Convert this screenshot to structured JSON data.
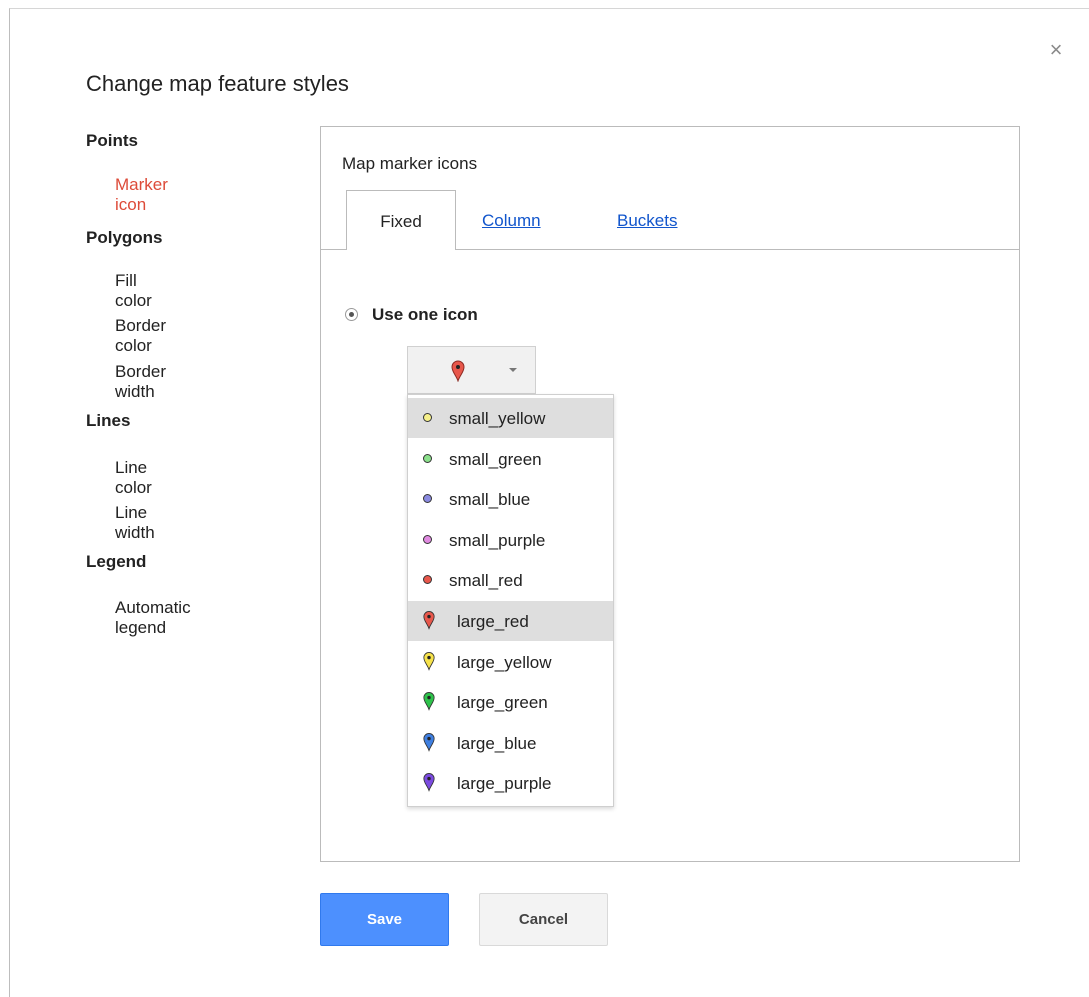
{
  "dialog": {
    "title": "Change map feature styles",
    "close_label": "×"
  },
  "nav": {
    "sections": [
      {
        "heading": "Points",
        "items": [
          "Marker icon"
        ]
      },
      {
        "heading": "Polygons",
        "items": [
          "Fill color",
          "Border color",
          "Border width"
        ]
      },
      {
        "heading": "Lines",
        "items": [
          "Line color",
          "Line width"
        ]
      },
      {
        "heading": "Legend",
        "items": [
          "Automatic legend"
        ]
      }
    ],
    "active_item": "Marker icon"
  },
  "panel": {
    "title": "Map marker icons",
    "tabs": [
      {
        "label": "Fixed",
        "active": true
      },
      {
        "label": "Column",
        "active": false
      },
      {
        "label": "Buckets",
        "active": false
      }
    ],
    "option_label": "Use one icon",
    "selected_icon": "large_red",
    "icon_options": [
      {
        "label": "small_yellow",
        "kind": "small",
        "color": "#f6f08a",
        "highlighted": true
      },
      {
        "label": "small_green",
        "kind": "small",
        "color": "#8be08b",
        "highlighted": false
      },
      {
        "label": "small_blue",
        "kind": "small",
        "color": "#8a8ae0",
        "highlighted": false
      },
      {
        "label": "small_purple",
        "kind": "small",
        "color": "#e08ae0",
        "highlighted": false
      },
      {
        "label": "small_red",
        "kind": "small",
        "color": "#e8574b",
        "highlighted": false
      },
      {
        "label": "large_red",
        "kind": "large",
        "color": "#e8574b",
        "highlighted": true
      },
      {
        "label": "large_yellow",
        "kind": "large",
        "color": "#f6e24b",
        "highlighted": false
      },
      {
        "label": "large_green",
        "kind": "large",
        "color": "#2ec24b",
        "highlighted": false
      },
      {
        "label": "large_blue",
        "kind": "large",
        "color": "#3f7fe0",
        "highlighted": false
      },
      {
        "label": "large_purple",
        "kind": "large",
        "color": "#7b4be0",
        "highlighted": false
      }
    ]
  },
  "buttons": {
    "save": "Save",
    "cancel": "Cancel"
  },
  "colors": {
    "accent_red": "#dd4b39",
    "link_blue": "#1155cc",
    "save_blue": "#4d90fe"
  }
}
